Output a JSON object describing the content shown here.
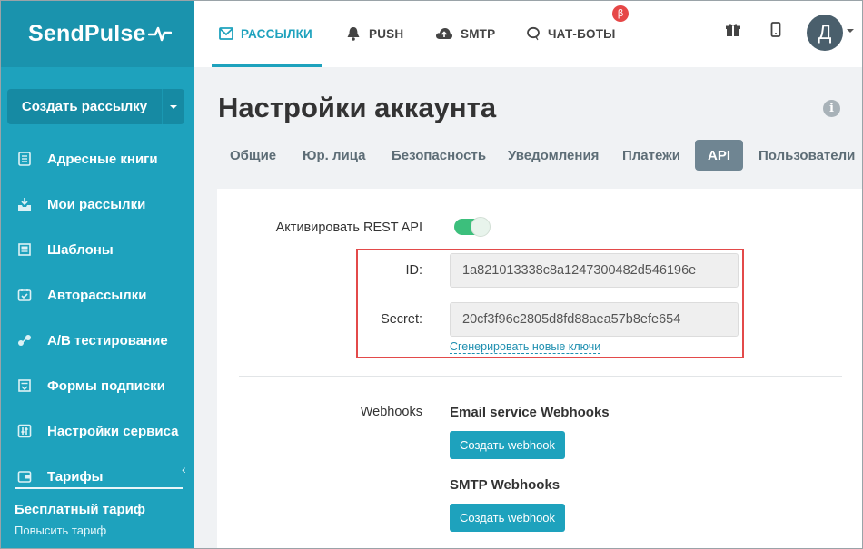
{
  "brand": {
    "name": "SendPulse"
  },
  "sidebar": {
    "create_label": "Создать рассылку",
    "items": [
      {
        "label": "Адресные книги",
        "icon": "address-book-icon"
      },
      {
        "label": "Мои рассылки",
        "icon": "mailings-icon"
      },
      {
        "label": "Шаблоны",
        "icon": "templates-icon"
      },
      {
        "label": "Авторассылки",
        "icon": "automation-icon"
      },
      {
        "label": "A/B тестирование",
        "icon": "ab-test-icon"
      },
      {
        "label": "Формы подписки",
        "icon": "forms-icon"
      },
      {
        "label": "Настройки сервиса",
        "icon": "settings-sliders-icon"
      },
      {
        "label": "Тарифы",
        "icon": "wallet-icon"
      }
    ],
    "plan_title": "Бесплатный тариф",
    "plan_link": "Повысить тариф"
  },
  "topbar": {
    "tabs": [
      {
        "label": "РАССЫЛКИ",
        "icon": "envelope-icon",
        "active": true
      },
      {
        "label": "PUSH",
        "icon": "bell-icon",
        "active": false
      },
      {
        "label": "SMTP",
        "icon": "cloud-upload-icon",
        "active": false
      },
      {
        "label": "ЧАТ-БОТЫ",
        "icon": "chat-icon",
        "active": false
      }
    ],
    "beta_badge": "β",
    "avatar_letter": "Д"
  },
  "page": {
    "title": "Настройки аккаунта",
    "tabs": [
      "Общие",
      "Юр. лица",
      "Безопасность",
      "Уведомления",
      "Платежи",
      "API",
      "Пользователи"
    ],
    "active_tab": "API"
  },
  "api": {
    "activate_label": "Активировать REST API",
    "activate_on": true,
    "id_label": "ID:",
    "id_value": "1a821013338c8a1247300482d546196e",
    "secret_label": "Secret:",
    "secret_value": "20cf3f96c2805d8fd88aea57b8efe654",
    "regenerate_link": "Сгенерировать новые ключи"
  },
  "webhooks": {
    "label": "Webhooks",
    "email_title": "Email service Webhooks",
    "email_button": "Создать webhook",
    "smtp_title": "SMTP Webhooks",
    "smtp_button": "Создать webhook"
  },
  "colors": {
    "accent": "#1ea2bd",
    "toggle_on": "#3cbf7c",
    "highlight": "#e34a4a"
  }
}
